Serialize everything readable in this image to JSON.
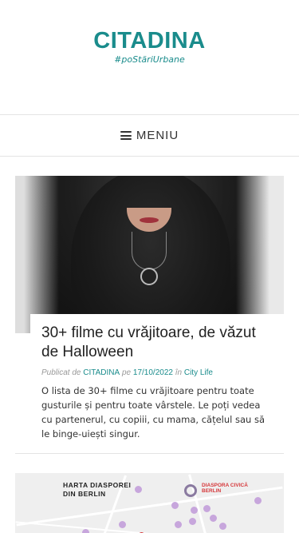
{
  "header": {
    "site_title": "CITADINA",
    "tagline": "#poStăriUrbane"
  },
  "nav": {
    "menu_label": "MENIU"
  },
  "post": {
    "title": "30+ filme cu vrăjitoare, de văzut de Halloween",
    "meta_published": "Publicat de",
    "author": "CITADINA",
    "meta_on": "pe",
    "date": "17/10/2022",
    "meta_in": "în",
    "category": "City Life",
    "excerpt": "O lista de 30+ filme cu vrăjitoare pentru toate gusturile și pentru toate vârstele. Le poți vedea cu partenerul, cu copiii, cu mama, cățelul sau să le binge-uiești singur."
  },
  "next_post": {
    "map_title": "HARTA DIASPOREI DIN BERLIN",
    "map_logo_text": "DIASPORA CIVICĂ BERLIN"
  },
  "colors": {
    "accent": "#1a8c8c",
    "background": "#ffffff",
    "divider": "#e4e4e4"
  }
}
